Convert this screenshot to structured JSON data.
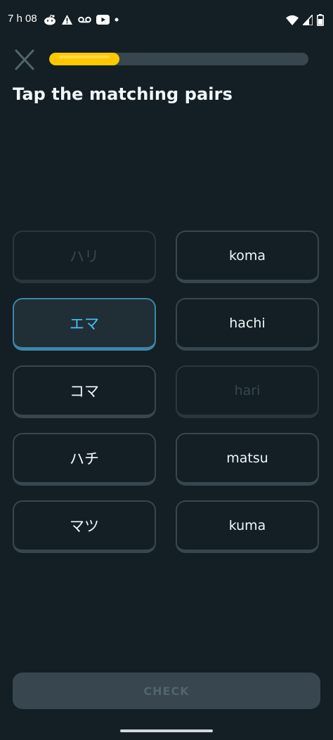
{
  "status_bar": {
    "time": "7 h 08",
    "left_icons": [
      "reddit-icon",
      "warning-icon",
      "voicemail-icon",
      "youtube-icon",
      "dot-icon"
    ],
    "right_icons": [
      "wifi-icon",
      "signal-icon",
      "battery-icon"
    ]
  },
  "header": {
    "close_icon": "close-icon",
    "progress_fraction": 0.27
  },
  "page": {
    "title": "Tap the matching pairs"
  },
  "pairs": {
    "left": [
      {
        "label": "ハリ",
        "state": "done"
      },
      {
        "label": "エマ",
        "state": "selected"
      },
      {
        "label": "コマ",
        "state": "default"
      },
      {
        "label": "ハチ",
        "state": "default"
      },
      {
        "label": "マツ",
        "state": "default"
      }
    ],
    "right": [
      {
        "label": "koma",
        "state": "default"
      },
      {
        "label": "hachi",
        "state": "default"
      },
      {
        "label": "hari",
        "state": "done"
      },
      {
        "label": "matsu",
        "state": "default"
      },
      {
        "label": "kuma",
        "state": "default"
      }
    ]
  },
  "footer": {
    "check_label": "CHECK"
  },
  "colors": {
    "background": "#131f24",
    "progress": "#ffc800",
    "selected_text": "#49c0f8",
    "selected_border": "#3f85a7",
    "tile_border": "#37464f"
  }
}
